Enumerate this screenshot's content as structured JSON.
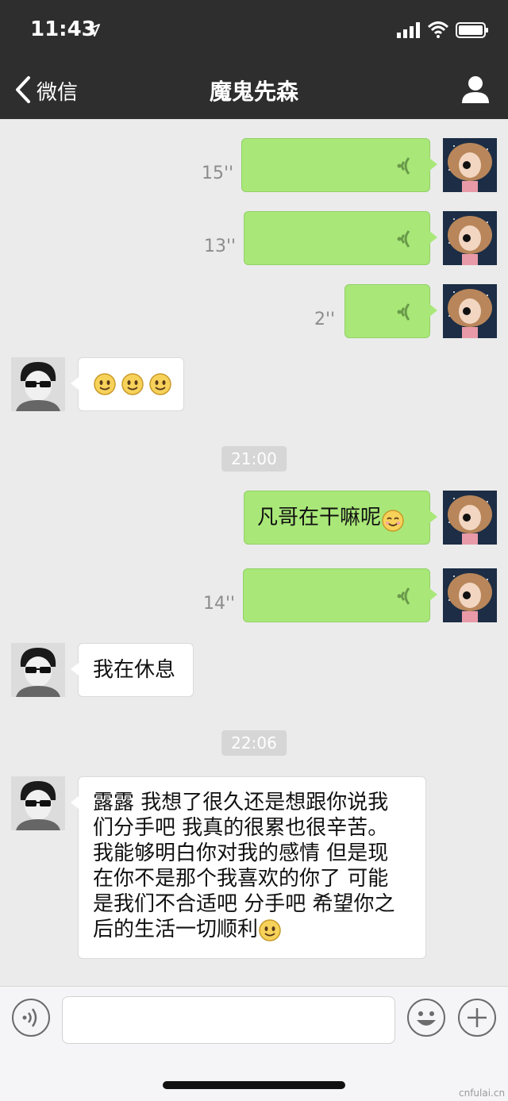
{
  "status_bar": {
    "time": "11:43"
  },
  "nav": {
    "back_label": "微信",
    "title": "魔鬼先森"
  },
  "messages": [
    {
      "side": "out",
      "type": "voice",
      "duration": "15''"
    },
    {
      "side": "out",
      "type": "voice",
      "duration": "13''"
    },
    {
      "side": "out",
      "type": "voice",
      "duration": "2''"
    },
    {
      "side": "in",
      "type": "emoji",
      "emoji": [
        "smile",
        "smile",
        "smile"
      ]
    },
    {
      "type": "time",
      "text": "21:00"
    },
    {
      "side": "out",
      "type": "text",
      "text": "凡哥在干嘛呢",
      "emoji": "smile"
    },
    {
      "side": "out",
      "type": "voice",
      "duration": "14''"
    },
    {
      "side": "in",
      "type": "text",
      "text": "我在休息"
    },
    {
      "type": "time",
      "text": "22:06"
    },
    {
      "side": "in",
      "type": "text",
      "lines": [
        "露露 我想了很久还是想跟你说我",
        "们分手吧 我真的很累也很辛苦。",
        "我能够明白你对我的感情 但是现",
        "在你不是那个我喜欢的你了 可能",
        "是我们不合适吧 分手吧 希望你之",
        "后的生活一切顺利"
      ],
      "emoji": "smile"
    }
  ],
  "input": {
    "placeholder": ""
  },
  "watermark": "cnfulai.cn",
  "colors": {
    "outgoing_bubble": "#a9e878",
    "incoming_bubble": "#ffffff",
    "header": "#2e2e2e",
    "chat_bg": "#ebebeb"
  }
}
